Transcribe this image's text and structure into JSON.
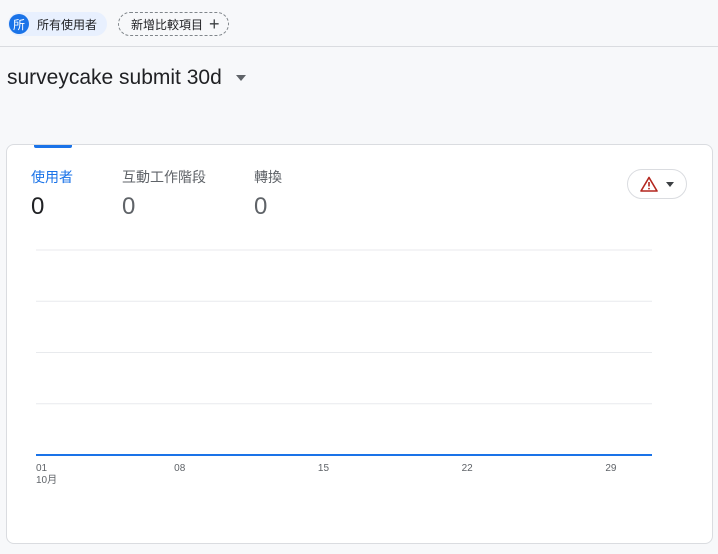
{
  "chips": {
    "audience": {
      "avatar": "所",
      "label": "所有使用者"
    },
    "compare": {
      "label": "新增比較項目",
      "icon": "plus-icon"
    }
  },
  "report": {
    "title": "surveycake submit 30d"
  },
  "metrics": [
    {
      "label": "使用者",
      "value": "0",
      "active": true
    },
    {
      "label": "互動工作階段",
      "value": "0",
      "active": false
    },
    {
      "label": "轉換",
      "value": "0",
      "active": false
    }
  ],
  "alert": {
    "icon": "warning-icon",
    "color": "#b3261e"
  },
  "colors": {
    "accent": "#1a73e8",
    "grid": "#e8eaed"
  },
  "chart_data": {
    "type": "line",
    "x": [
      "01",
      "08",
      "15",
      "22",
      "29"
    ],
    "x_month_label": "10月",
    "series": [
      {
        "values": [
          0,
          0,
          0,
          0,
          0
        ]
      }
    ],
    "ylim": [
      0,
      1
    ],
    "grid": true
  }
}
